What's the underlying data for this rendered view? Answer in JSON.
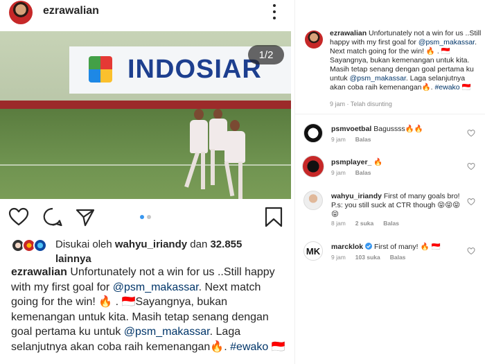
{
  "post": {
    "username": "ezrawalian",
    "media_counter": "1/2",
    "billboard_text": "INDOSIAR",
    "carousel": {
      "count": 2,
      "active_index": 0
    },
    "likes": {
      "prefix": "Disukai oleh",
      "user": "wahyu_iriandy",
      "middle": "dan",
      "count": "32.855",
      "suffix": "lainnya"
    },
    "caption": {
      "username": "ezrawalian",
      "part1": "Unfortunately not a win for us ..Still happy with my first goal for",
      "mention1": "@psm_makassar",
      "part2": ". Next match going for the win! 🔥 . 🇮🇩Sayangnya, bukan kemenangan untuk kita. Masih tetap senang dengan goal pertama ku untuk",
      "mention2": "@psm_makassar",
      "part3": ". Laga selanjutnya akan coba raih kemenangan🔥.",
      "hashtag": "#ewako",
      "flag": "🇮🇩"
    },
    "caption_meta": "9 jam · Telah disunting"
  },
  "comments": [
    {
      "username": "psmvoetbal",
      "text": "Bagussss🔥🔥",
      "time": "9 jam",
      "likes": "",
      "reply": "Balas"
    },
    {
      "username": "psmplayer_",
      "text": "🔥",
      "time": "9 jam",
      "likes": "",
      "reply": "Balas"
    },
    {
      "username": "wahyu_iriandy",
      "text": "First of many goals bro! P.s: you still suck at CTR though 😝😝😝😝",
      "time": "8 jam",
      "likes": "2 suka",
      "reply": "Balas"
    },
    {
      "username": "marcklok",
      "text": "First of many! 🔥 🇮🇩",
      "time": "9 jam",
      "likes": "103 suka",
      "reply": "Balas"
    }
  ],
  "colors": {
    "text": "#262626",
    "muted": "#8e8e8e",
    "link": "#003569",
    "active_dot": "#3897f0",
    "verified": "#3897f0"
  },
  "icons": [
    "more-icon",
    "heart-icon",
    "comment-icon",
    "share-icon",
    "bookmark-icon",
    "verified-icon"
  ]
}
